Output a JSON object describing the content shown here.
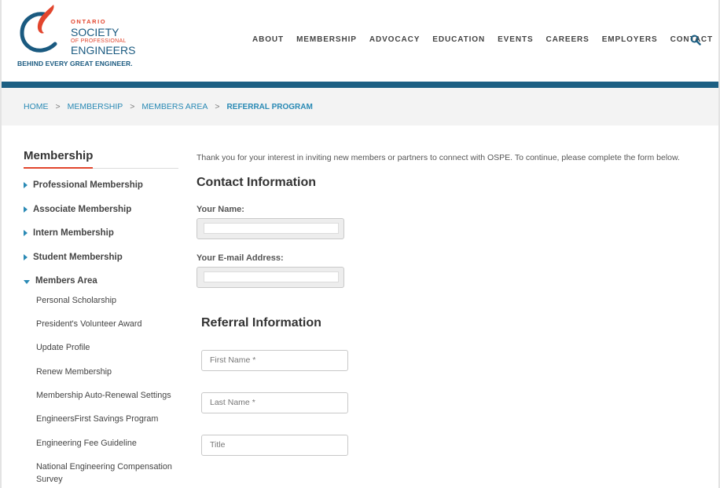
{
  "brand": {
    "line1": "ONTARIO",
    "line2": "SOCIETY",
    "line3": "OF PROFESSIONAL",
    "line4": "ENGINEERS",
    "tagline": "BEHIND EVERY GREAT ENGINEER.",
    "colors": {
      "navy": "#1a5a80",
      "red": "#e2452d",
      "bar": "#1c5f83",
      "link": "#2a8ab5"
    }
  },
  "nav": {
    "items": [
      "ABOUT",
      "MEMBERSHIP",
      "ADVOCACY",
      "EDUCATION",
      "EVENTS",
      "CAREERS",
      "EMPLOYERS",
      "CONTACT"
    ],
    "search_icon": "search-icon"
  },
  "breadcrumb": {
    "home": "HOME",
    "membership": "MEMBERSHIP",
    "members_area": "MEMBERS AREA",
    "current": "REFERRAL PROGRAM",
    "separator": ">"
  },
  "sidebar": {
    "title": "Membership",
    "items": [
      "Professional Membership",
      "Associate Membership",
      "Intern Membership",
      "Student Membership"
    ],
    "open_item": "Members Area",
    "sub_items": [
      "Personal Scholarship",
      "President's Volunteer Award",
      "Update Profile",
      "Renew Membership",
      "Membership Auto-Renewal Settings",
      "EngineersFirst Savings Program",
      "Engineering Fee Guideline",
      "National Engineering Compensation Survey"
    ]
  },
  "main": {
    "intro": "Thank you for your interest in inviting new members or partners to connect with OSPE. To continue, please complete the form below.",
    "contact_heading": "Contact Information",
    "name_label": "Your Name:",
    "email_label": "Your E-mail Address:",
    "referral_heading": "Referral Information",
    "first_name_placeholder": "First Name *",
    "last_name_placeholder": "Last Name *",
    "title_placeholder": "Title"
  }
}
